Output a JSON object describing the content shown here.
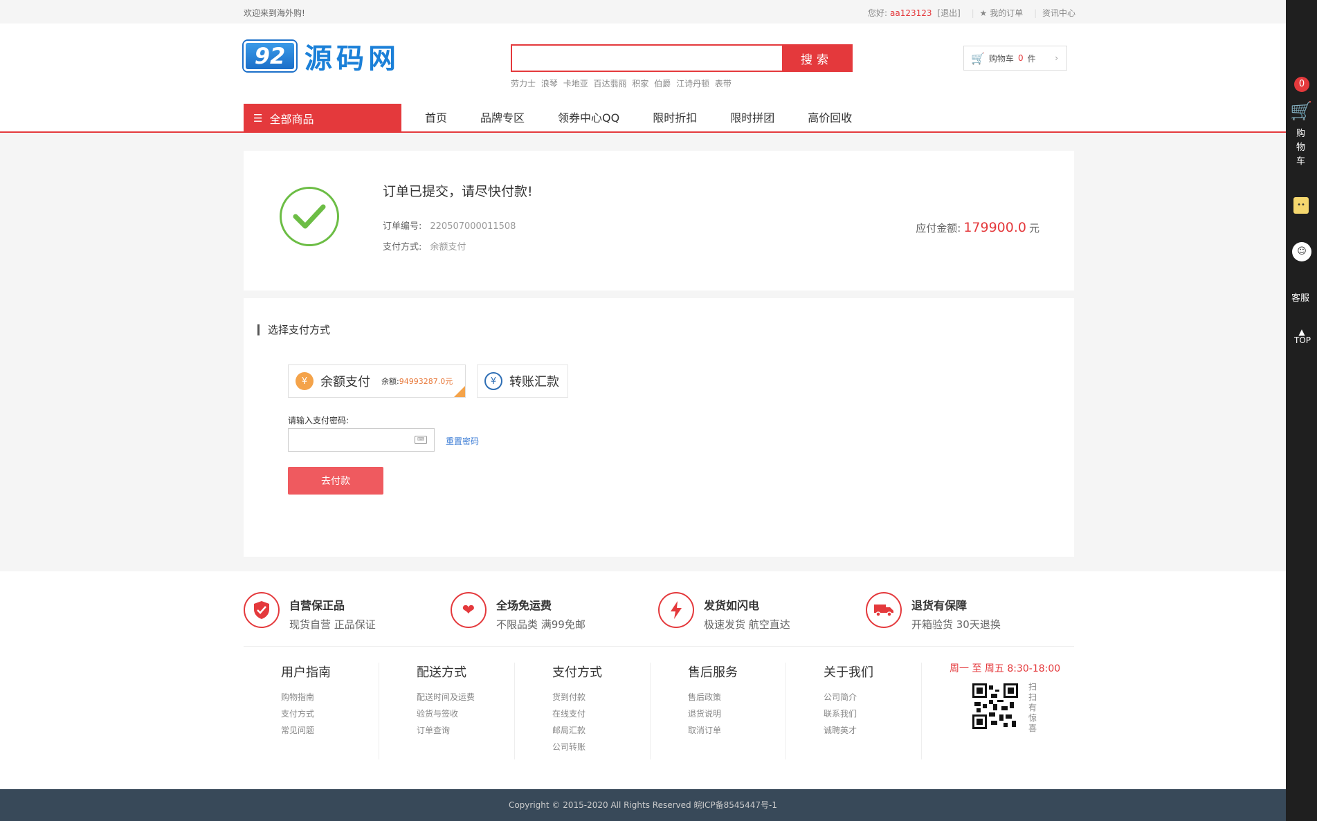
{
  "topbar": {
    "welcome": "欢迎来到海外购!",
    "greeting": "您好:",
    "username": "aa123123",
    "logout": "[退出]",
    "my_orders": "我的订单",
    "news": "资讯中心"
  },
  "header": {
    "logo_badge": "92",
    "logo_text": "源码网",
    "search_placeholder": "",
    "search_button": "搜索",
    "hot_words": [
      "劳力士",
      "浪琴",
      "卡地亚",
      "百达翡丽",
      "积家",
      "伯爵",
      "江诗丹顿",
      "表带"
    ],
    "cart_label": "购物车",
    "cart_count": "0",
    "cart_unit": "件"
  },
  "nav": {
    "all_categories": "全部商品",
    "items": [
      "首页",
      "品牌专区",
      "领券中心QQ",
      "限时折扣",
      "限时拼团",
      "高价回收"
    ]
  },
  "order": {
    "title": "订单已提交，请尽快付款!",
    "order_no_label": "订单编号:",
    "order_no": "220507000011508",
    "pay_method_label": "支付方式:",
    "pay_method": "余额支付",
    "amount_label": "应付金额:",
    "amount": "179900.0",
    "amount_unit": "元"
  },
  "payment": {
    "section_title": "选择支付方式",
    "options": [
      {
        "label": "余额支付",
        "balance_label": "余额:",
        "balance": "94993287.0元",
        "icon": "money-bag-icon"
      },
      {
        "label": "转账汇款",
        "icon": "yen-transfer-icon"
      }
    ],
    "password_label": "请输入支付密码:",
    "password_value": "",
    "reset_link": "重置密码",
    "submit_button": "去付款"
  },
  "guarantees": [
    {
      "title": "自营保正品",
      "desc": "现货自营 正品保证",
      "icon": "shield-check-icon"
    },
    {
      "title": "全场免运费",
      "desc": "不限品类 满99免邮",
      "icon": "heart-hands-icon"
    },
    {
      "title": "发货如闪电",
      "desc": "极速发货 航空直达",
      "icon": "lightning-icon"
    },
    {
      "title": "退货有保障",
      "desc": "开箱验货 30天退换",
      "icon": "truck-icon"
    }
  ],
  "footer_columns": [
    {
      "heading": "用户指南",
      "links": [
        "购物指南",
        "支付方式",
        "常见问题"
      ]
    },
    {
      "heading": "配送方式",
      "links": [
        "配送时间及运费",
        "验货与签收",
        "订单查询"
      ]
    },
    {
      "heading": "支付方式",
      "links": [
        "货到付款",
        "在线支付",
        "邮局汇款",
        "公司转账"
      ]
    },
    {
      "heading": "售后服务",
      "links": [
        "售后政策",
        "退货说明",
        "取消订单"
      ]
    },
    {
      "heading": "关于我们",
      "links": [
        "公司简介",
        "联系我们",
        "诚聘英才"
      ]
    }
  ],
  "service_hours": "周一 至 周五    8:30-18:00",
  "scan_text": "扫扫有惊喜",
  "copyright": "Copyright © 2015-2020 All Rights Reserved 皖ICP备8545447号-1",
  "sidebar": {
    "cart_badge": "0",
    "cart_label": "购物车",
    "service_label": "客服",
    "top_label": "TOP"
  },
  "colors": {
    "accent": "#e4393c",
    "success": "#6cbd45",
    "footer_bg": "#384959",
    "sidebar_bg": "#1f1f1f"
  }
}
